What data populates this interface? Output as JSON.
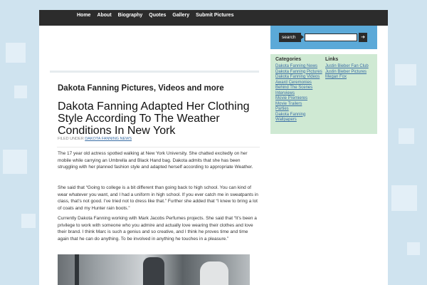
{
  "nav": {
    "items": [
      "Home",
      "About",
      "Biography",
      "Quotes",
      "Gallery",
      "Submit Pictures"
    ]
  },
  "site": {
    "title": "Dakota Fanning Pictures, Videos and more"
  },
  "post": {
    "title": "Dakota Fanning Adapted Her Clothing Style According To The Weather Conditions In New York",
    "filed_prefix": "FILED UNDER",
    "category": "DAKOTA FANNING NEWS",
    "paragraphs": [
      "The 17 year old actress spotted walking at New York University. She chatted excitedly on her mobile while carrying an Umbrella and Black Hand bag. Dakota admits that she has been struggling with her planned fashion style and adapted herself according to appropriate Weather.",
      "She said that “Going to college is a bit different than going back to high school. You can kind of wear whatever you want, and I had a uniform in high school. If you ever catch me in sweatpants in class, that’s not good. I’ve tried not to dress like that.” Further she added that “I knew to bring a lot of coats and my Hunter rain boots.”",
      "Currently Dakota Fanning working with Mark Jacobs Perfumes projects. She said that “It’s been a privilege to work with someone who you admire and actually love wearing their clothes and love their brand. I think Marc is such a genius and so creative, and I think he proves time and time again that he can do anything. To be involved in anything he touches in a pleasure.”"
    ]
  },
  "search": {
    "label": "search",
    "value": "",
    "go": "➔"
  },
  "categories": {
    "heading": "Categories",
    "items": [
      "Dakota Fanning News",
      "Dakota Fanning Pictures",
      "Dakota Fanning Videos",
      "Award Ceremonies",
      "Behind The Scenes",
      "Interviews",
      "Movie Premieres",
      "Movie Trailers",
      "Parties",
      "Dakota Fanning Wallpapers"
    ]
  },
  "links": {
    "heading": "Links",
    "items": [
      "Justin Bieber Fan Club",
      "Justin Bieber Pictures",
      "Megan Fox"
    ]
  },
  "colors": {
    "accent": "#5ba9d8",
    "nav_bg": "#2c2c2c",
    "sidebar_box": "#cfe9d3",
    "link": "#3a6ea5"
  }
}
